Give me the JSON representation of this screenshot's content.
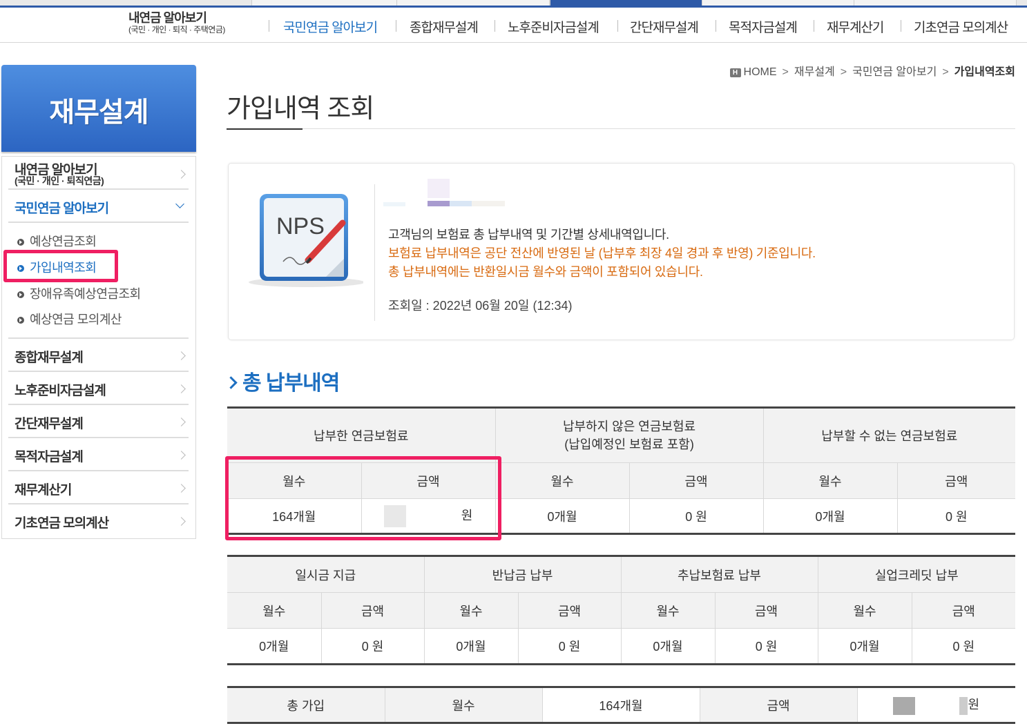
{
  "gnb": {
    "first_line1": "내연금 알아보기",
    "first_line2": "(국민 · 개인 · 퇴직 · 주택연금)",
    "items": [
      "국민연금 알아보기",
      "종합재무설계",
      "노후준비자금설계",
      "간단재무설계",
      "목적자금설계",
      "재무계산기",
      "기초연금 모의계산"
    ]
  },
  "lnb": {
    "title": "재무설계",
    "item1_line1": "내연금 알아보기",
    "item1_line2": "(국민 · 개인  · 퇴직연금)",
    "item2": "국민연금 알아보기",
    "subs": [
      "예상연금조회",
      "가입내역조회",
      "장애유족예상연금조회",
      "예상연금 모의계산"
    ],
    "items": [
      "종합재무설계",
      "노후준비자금설계",
      "간단재무설계",
      "목적자금설계",
      "재무계산기",
      "기초연금 모의계산"
    ]
  },
  "breadcrumb": {
    "home_icon": "H",
    "home": "HOME",
    "sep": ">",
    "c1": "재무설계",
    "c2": "국민연금 알아보기",
    "current": "가입내역조회"
  },
  "page_title": "가입내역 조회",
  "info": {
    "icon_label": "NPS",
    "line1": "고객님의 보험료 총 납부내역 및 기간별 상세내역입니다.",
    "line2": "보험료 납부내역은 공단 전산에 반영된 날 (납부후 최장 4일 경과 후 반영) 기준입니다.",
    "line3": "총 납부내역에는 반환일시금 월수와 금액이 포함되어 있습니다.",
    "date": "조회일 : 2022년 06월 20일 (12:34)"
  },
  "section_title": "총 납부내역",
  "table1": {
    "headers": [
      "납부한 연금보험료",
      "납부하지 않은 연금보험료",
      "(납입예정인 보험료 포함)",
      "납부할 수 없는 연금보험료"
    ],
    "sub": [
      "월수",
      "금액"
    ],
    "values": [
      "164개월",
      "원",
      "0개월",
      "0 원",
      "0개월",
      "0 원"
    ]
  },
  "table2": {
    "headers": [
      "일시금 지급",
      "반납금 납부",
      "추납보험료 납부",
      "실업크레딧 납부"
    ],
    "sub": [
      "월수",
      "금액"
    ],
    "values": [
      "0개월",
      "0 원",
      "0개월",
      "0 원",
      "0개월",
      "0 원",
      "0개월",
      "0 원"
    ]
  },
  "table3": {
    "label": "총 가입",
    "months_label": "월수",
    "months": "164개월",
    "amount_label": "금액",
    "amount_unit": "원"
  },
  "colors": {
    "accent": "#1d6fc1",
    "highlight": "#ef1f62",
    "notice": "#d86a10"
  }
}
